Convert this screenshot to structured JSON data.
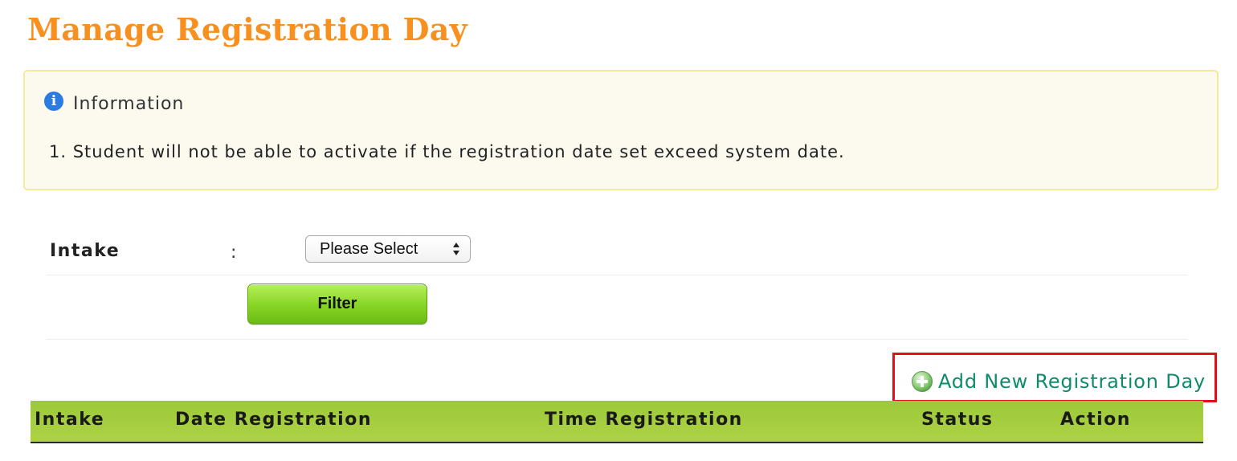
{
  "page": {
    "title": "Manage Registration Day"
  },
  "info": {
    "icon": "info-icon",
    "icon_glyph": "i",
    "heading": "Information",
    "items": [
      "1.  Student will not be able to activate if the registration date set exceed system date."
    ]
  },
  "filter": {
    "intake_label": "Intake",
    "separator": ":",
    "intake_select_value": "Please Select",
    "filter_button_label": "Filter"
  },
  "add_link": {
    "icon": "add-circle-icon",
    "label": "Add New Registration Day"
  },
  "table": {
    "columns": [
      "Intake",
      "Date Registration",
      "Time Registration",
      "Status",
      "Action"
    ]
  },
  "colors": {
    "title": "#f7901e",
    "link": "#0e8c6a",
    "highlight_border": "#e3101a",
    "header_green": "#aed245",
    "button_green": "#86d424"
  }
}
